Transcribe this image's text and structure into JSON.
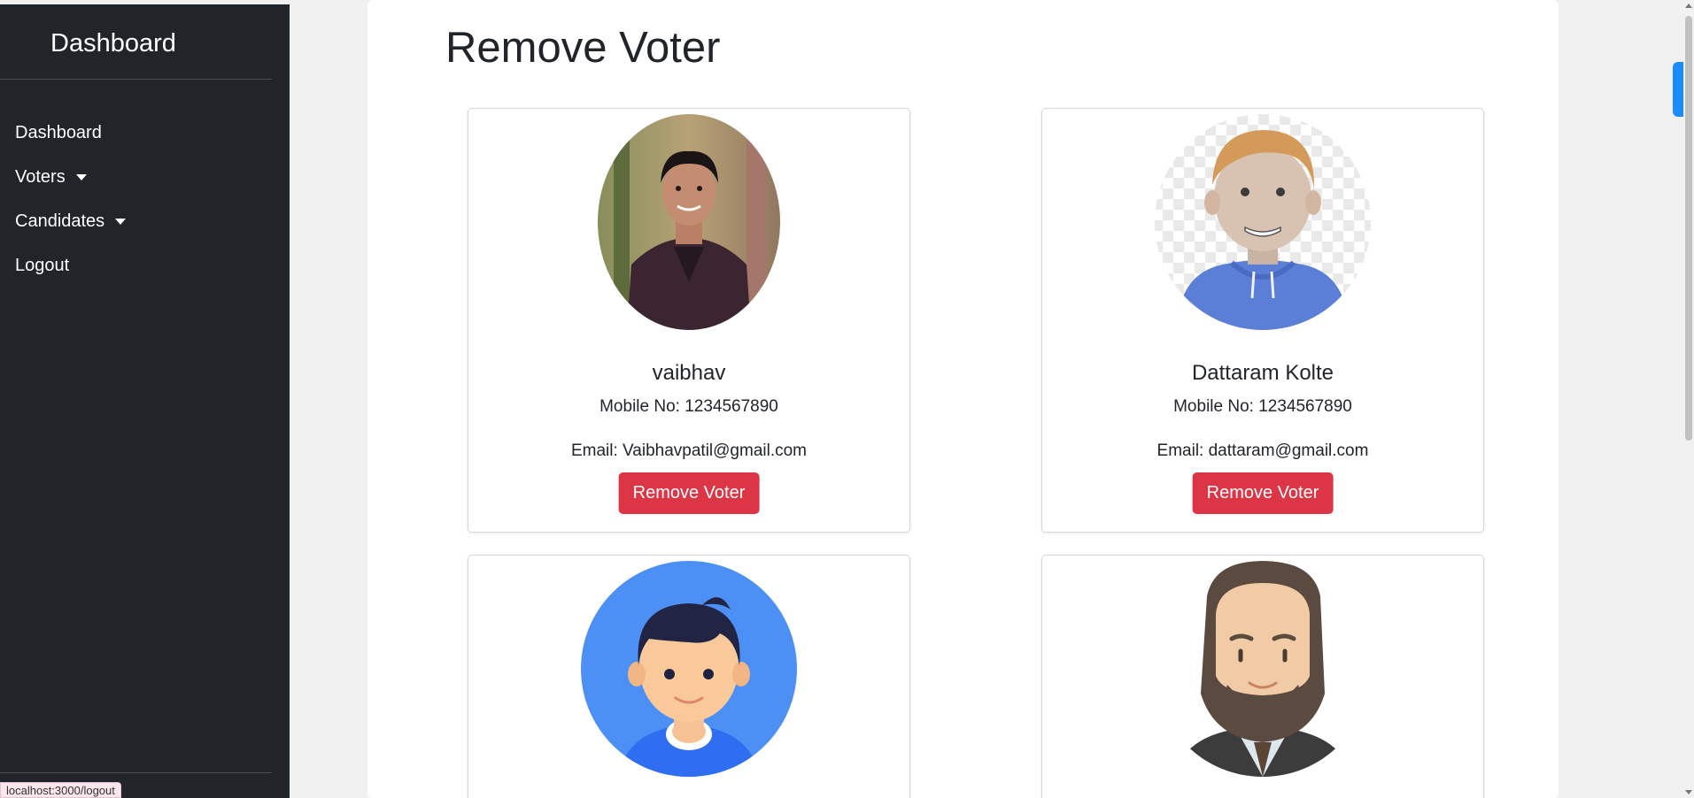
{
  "sidebar": {
    "title": "Dashboard",
    "items": [
      {
        "label": "Dashboard",
        "dropdown": false
      },
      {
        "label": "Voters",
        "dropdown": true
      },
      {
        "label": "Candidates",
        "dropdown": true
      },
      {
        "label": "Logout",
        "dropdown": false
      }
    ]
  },
  "status_bar": {
    "url": "localhost:3000/logout"
  },
  "main": {
    "title": "Remove Voter",
    "voters": [
      {
        "name": "vaibhav",
        "mobile": "Mobile No: 1234567890",
        "email": "Email: Vaibhavpatil@gmail.com",
        "button": "Remove Voter",
        "avatar": "photo-avatar-icon"
      },
      {
        "name": "Dattaram Kolte",
        "mobile": "Mobile No: 1234567890",
        "email": "Email: dattaram@gmail.com",
        "button": "Remove Voter",
        "avatar": "3d-avatar-icon"
      },
      {
        "name": "",
        "mobile": "",
        "email": "",
        "button": "",
        "avatar": "cartoon-boy-avatar-icon"
      },
      {
        "name": "",
        "mobile": "",
        "email": "",
        "button": "",
        "avatar": "bearded-man-avatar-icon"
      }
    ]
  },
  "colors": {
    "sidebar_bg": "#212529",
    "danger": "#dc3545",
    "page_bg": "#f1f1f1",
    "accent_tab": "#1a8cff"
  }
}
